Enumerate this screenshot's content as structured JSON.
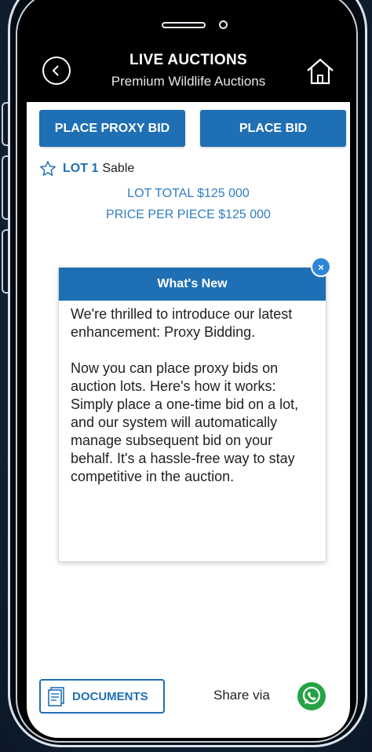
{
  "header": {
    "title": "LIVE AUCTIONS",
    "subtitle": "Premium Wildlife Auctions"
  },
  "actions": {
    "proxy_bid_label": "PLACE PROXY BID",
    "bid_label": "PLACE BID"
  },
  "lot": {
    "number": "LOT 1",
    "name": "Sable",
    "total": "LOT TOTAL $125 000",
    "price_per_piece": "PRICE PER PIECE $125 000"
  },
  "modal": {
    "title": "What's New",
    "paragraph_1": "We're thrilled to introduce our latest enhancement: Proxy Bidding.",
    "paragraph_2": "Now you can place proxy bids on auction lots. Here's how it works: Simply place a one-time bid on a lot, and our system will automatically manage subsequent bid on your behalf. It's a hassle-free way to stay competitive in the auction.",
    "close_icon": "×"
  },
  "footer": {
    "documents_label": "DOCUMENTS",
    "share_label": "Share via"
  },
  "icons": {
    "back": "chevron-left-circle-icon",
    "home": "home-icon",
    "star": "star-outline-icon",
    "documents": "document-icon",
    "share": "whatsapp-icon",
    "close": "close-icon"
  },
  "colors": {
    "primary": "#1f6fb5",
    "accent_text": "#2f7dc1",
    "whatsapp": "#25a244",
    "header_bg": "#000000"
  }
}
